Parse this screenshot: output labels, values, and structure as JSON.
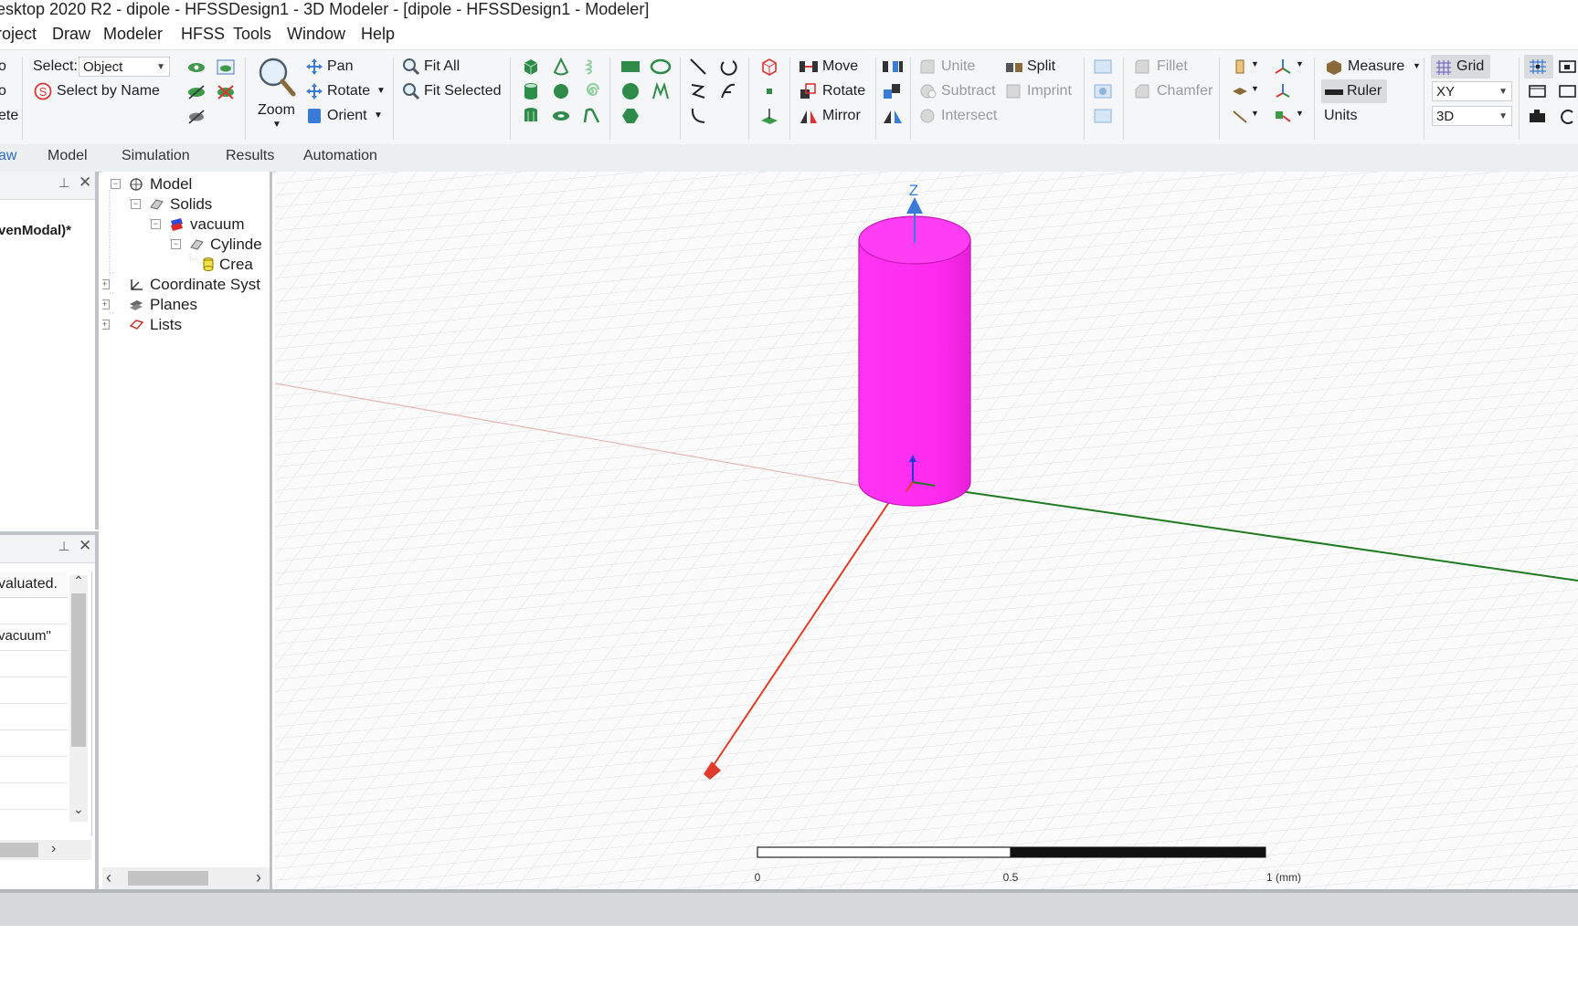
{
  "window": {
    "title": "esktop 2020 R2 - dipole - HFSSDesign1 - 3D Modeler - [dipole - HFSSDesign1 - Modeler]"
  },
  "menu": [
    "roject",
    "Draw",
    "Modeler",
    "HFSS",
    "Tools",
    "Window",
    "Help"
  ],
  "ribbon": {
    "partial_left": [
      "o",
      "o",
      "ete"
    ],
    "select_label": "Select:",
    "select_value": "Object",
    "select_by_name": "Select by Name",
    "zoom": "Zoom",
    "pan": "Pan",
    "rotate_view": "Rotate",
    "orient": "Orient",
    "fit_all": "Fit All",
    "fit_selected": "Fit Selected",
    "move": "Move",
    "rotate": "Rotate",
    "mirror": "Mirror",
    "unite": "Unite",
    "subtract": "Subtract",
    "intersect": "Intersect",
    "split": "Split",
    "imprint": "Imprint",
    "fillet": "Fillet",
    "chamfer": "Chamfer",
    "measure": "Measure",
    "ruler": "Ruler",
    "units": "Units",
    "grid": "Grid",
    "plane_value": "XY",
    "dim_value": "3D"
  },
  "tabs": [
    {
      "label": "aw",
      "active": true
    },
    {
      "label": "Model",
      "active": false
    },
    {
      "label": "Simulation",
      "active": false
    },
    {
      "label": "Results",
      "active": false
    },
    {
      "label": "Automation",
      "active": false
    }
  ],
  "project_pane": {
    "item": "venModal)*"
  },
  "props_pane": {
    "header": "valuated.",
    "value": "vacuum\""
  },
  "tree": {
    "model": "Model",
    "solids": "Solids",
    "vacuum": "vacuum",
    "cylinder": "Cylinde",
    "create": "Crea",
    "coordsys": "Coordinate Syst",
    "planes": "Planes",
    "lists": "Lists"
  },
  "viewport": {
    "axis_z": "Z",
    "scale_labels": [
      "0",
      "0.5",
      "1 (mm)"
    ],
    "object_color": "#ff2df4"
  },
  "colors": {
    "accent": "#2b6cc4",
    "x_axis": "#e03b2a",
    "y_axis": "#1f7a1f",
    "z_axis": "#3a7bd5"
  }
}
